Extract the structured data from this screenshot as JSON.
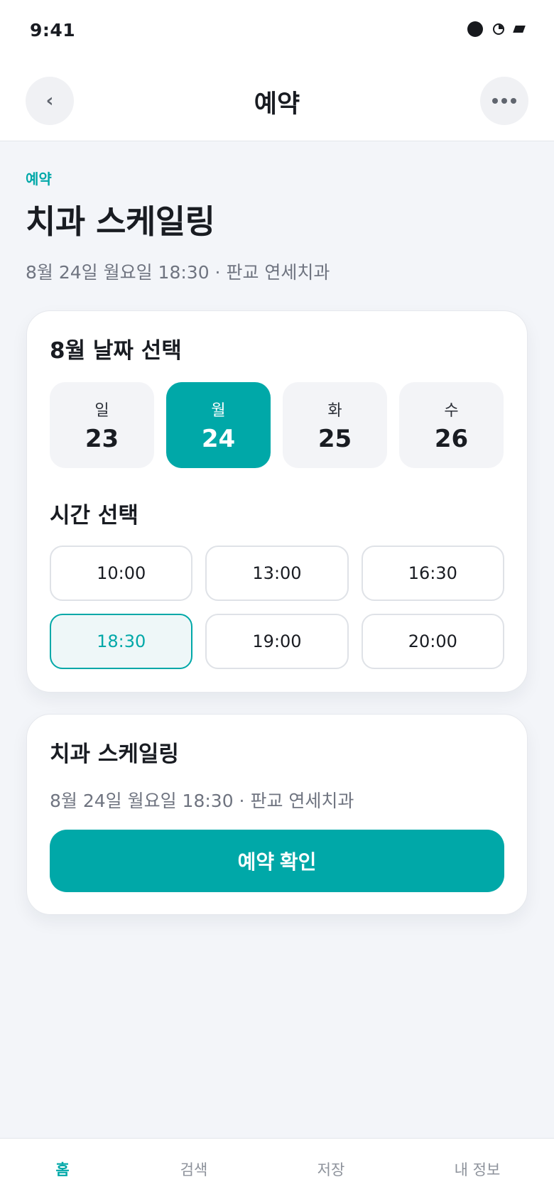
{
  "status": {
    "time": "9:41"
  },
  "header": {
    "title": "예약",
    "back_glyph": "‹"
  },
  "intro": {
    "eyebrow": "예약",
    "title": "치과 스케일링",
    "subtitle": "8월 24일 월요일 18:30 · 판교 연세치과"
  },
  "date_section": {
    "title": "8월 날짜 선택",
    "dates": [
      {
        "dow": "일",
        "day": "23",
        "selected": false
      },
      {
        "dow": "월",
        "day": "24",
        "selected": true
      },
      {
        "dow": "화",
        "day": "25",
        "selected": false
      },
      {
        "dow": "수",
        "day": "26",
        "selected": false
      }
    ]
  },
  "time_section": {
    "title": "시간 선택",
    "slots": [
      {
        "label": "10:00",
        "selected": false
      },
      {
        "label": "13:00",
        "selected": false
      },
      {
        "label": "16:30",
        "selected": false
      },
      {
        "label": "18:30",
        "selected": true
      },
      {
        "label": "19:00",
        "selected": false
      },
      {
        "label": "20:00",
        "selected": false
      }
    ]
  },
  "summary": {
    "title": "치과 스케일링",
    "subtitle": "8월 24일 월요일 18:30 · 판교 연세치과",
    "confirm_label": "예약 확인"
  },
  "tabs": [
    {
      "label": "홈",
      "active": true
    },
    {
      "label": "검색",
      "active": false
    },
    {
      "label": "저장",
      "active": false
    },
    {
      "label": "내 정보",
      "active": false
    }
  ],
  "colors": {
    "accent": "#00a8a8",
    "background": "#f3f5f9",
    "text": "#191c22",
    "muted": "#6f7480"
  },
  "icons": [
    "camera-dot-icon",
    "wifi-icon",
    "battery-icon",
    "back-chevron-icon",
    "more-dots-icon"
  ]
}
